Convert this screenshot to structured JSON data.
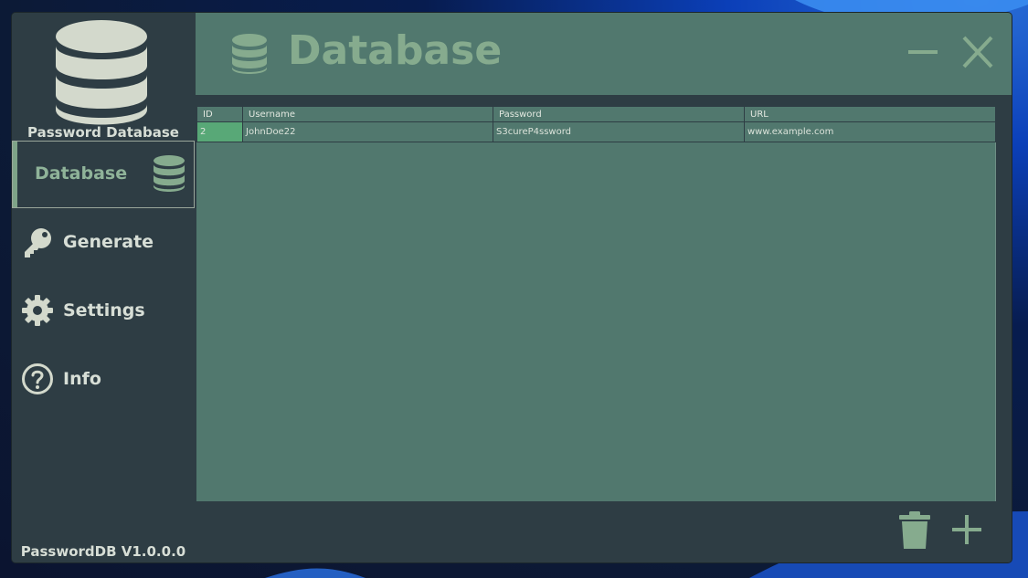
{
  "app": {
    "title": "Password Database",
    "version": "PasswordDB V1.0.0.0"
  },
  "sidebar": {
    "items": [
      {
        "label": "Database",
        "icon": "database-icon",
        "active": true
      },
      {
        "label": "Generate",
        "icon": "key-icon",
        "active": false
      },
      {
        "label": "Settings",
        "icon": "gear-icon",
        "active": false
      },
      {
        "label": "Info",
        "icon": "question-circle-icon",
        "active": false
      }
    ]
  },
  "header": {
    "title": "Database",
    "icon": "database-icon",
    "minimize_icon": "minimize-icon",
    "close_icon": "close-icon"
  },
  "table": {
    "columns": [
      "ID",
      "Username",
      "Password",
      "URL"
    ],
    "rows": [
      [
        "2",
        "JohnDoe22",
        "S3cureP4ssword",
        "www.example.com"
      ]
    ]
  },
  "actions": {
    "delete_icon": "trash-icon",
    "add_icon": "plus-icon"
  },
  "colors": {
    "sidebar_bg": "#2e3d44",
    "header_bg": "#51786e",
    "accent": "#86ab8e",
    "selected_cell": "#58a877",
    "text_light": "#d7ded6"
  }
}
